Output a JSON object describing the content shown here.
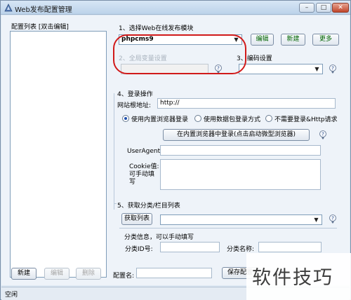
{
  "window": {
    "title": "Web发布配置管理",
    "controls": {
      "minimize": "–",
      "maximize": "□",
      "close": "✕"
    }
  },
  "left_panel": {
    "header": "配置列表  [双击编辑]",
    "new_button": "新建",
    "edit_button": "编辑",
    "delete_button": "删除"
  },
  "section1": {
    "title": "1、选择Web在线发布模块",
    "module_value": "phpcms9",
    "edit_button": "编辑",
    "new_button": "新建",
    "more_button": "更多"
  },
  "section2": {
    "title": "2、全局变量设置",
    "value": ""
  },
  "section3": {
    "title": "3、编码设置",
    "value": ""
  },
  "section4": {
    "title": "4、登录操作",
    "url_label": "网站根地址:",
    "url_value": "http://",
    "radio_builtin": "使用内置浏览器登录",
    "radio_packet": "使用数据包登录方式",
    "radio_none": "不需要登录&Http请求",
    "login_button": "在内置浏览器中登录(点击启动微型浏览器)",
    "useragent_label": "UserAgent",
    "useragent_value": "",
    "cookie_label": "Cookie值:",
    "cookie_note": "可手动填写",
    "cookie_value": ""
  },
  "section5": {
    "title": "5、获取分类/栏目列表",
    "fetch_button": "获取列表",
    "list_value": "",
    "info_label": "分类信息，可以手动填写",
    "category_id_label": "分类ID号:",
    "category_id_value": "",
    "category_name_label": "分类名称:",
    "category_name_value": ""
  },
  "bottom": {
    "config_name_label": "配置名:",
    "config_name_value": "",
    "save_button": "保存配置"
  },
  "statusbar": {
    "text": "空闲"
  },
  "watermark": {
    "text": "软件技巧"
  },
  "annotation": {
    "color": "#d11a1a"
  }
}
